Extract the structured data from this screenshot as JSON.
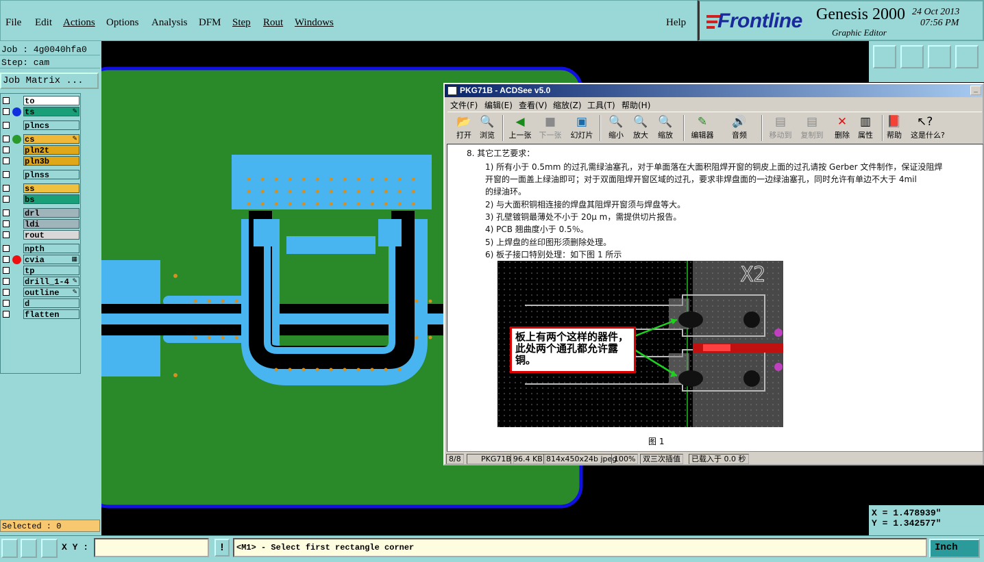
{
  "menu": {
    "items": [
      "File",
      "Edit",
      "Actions",
      "Options",
      "Analysis",
      "DFM",
      "Step",
      "Rout",
      "Windows"
    ],
    "help": "Help"
  },
  "brand": {
    "logo": "Frontline",
    "app_name": "Genesis 2000",
    "subtitle": "Graphic Editor",
    "date": "24 Oct 2013",
    "time": "07:56 PM"
  },
  "job": {
    "job_line": "Job : 4g0040hfa0",
    "step_line": "Step: cam",
    "matrix_button": "Job Matrix ..."
  },
  "layers": [
    {
      "name": "to",
      "color": "#ffffff",
      "dot": "",
      "flag": ""
    },
    {
      "name": "ts",
      "color": "#1aa079",
      "dot": "#1030e0",
      "flag": "✎"
    },
    {
      "name": "plncs",
      "color": "#9ad8d8",
      "dot": "",
      "flag": ""
    },
    {
      "name": "cs",
      "color": "#f0b838",
      "dot": "#2a9a2a",
      "flag": "✎"
    },
    {
      "name": "pln2t",
      "color": "#e0a818",
      "dot": "",
      "flag": ""
    },
    {
      "name": "pln3b",
      "color": "#e0a818",
      "dot": "",
      "flag": ""
    },
    {
      "name": "plnss",
      "color": "#9ad8d8",
      "dot": "",
      "flag": ""
    },
    {
      "name": "ss",
      "color": "#f0c040",
      "dot": "",
      "flag": ""
    },
    {
      "name": "bs",
      "color": "#1aa079",
      "dot": "",
      "flag": ""
    },
    {
      "name": "drl",
      "color": "#a0b4bc",
      "dot": "",
      "flag": ""
    },
    {
      "name": "ldi",
      "color": "#a0b4bc",
      "dot": "",
      "flag": ""
    },
    {
      "name": "rout",
      "color": "#d8d8d8",
      "dot": "",
      "flag": ""
    },
    {
      "name": "npth",
      "color": "#9ad8d8",
      "dot": "",
      "flag": ""
    },
    {
      "name": "cvia",
      "color": "#9ad8d8",
      "dot": "#ee1010",
      "flag": "▦"
    },
    {
      "name": "tp",
      "color": "#9ad8d8",
      "dot": "",
      "flag": ""
    },
    {
      "name": "drill_1-4",
      "color": "#9ad8d8",
      "dot": "",
      "flag": "✎"
    },
    {
      "name": "outline",
      "color": "#9ad8d8",
      "dot": "",
      "flag": "✎"
    },
    {
      "name": "d",
      "color": "#9ad8d8",
      "dot": "",
      "flag": ""
    },
    {
      "name": "flatten",
      "color": "#9ad8d8",
      "dot": "",
      "flag": ""
    }
  ],
  "selected": "Selected : 0",
  "coords": {
    "x": "X = 1.478939\"",
    "y": "Y = 1.342577\""
  },
  "bottom": {
    "xy_label": "X Y :",
    "xy_value": "",
    "prompt": "<M1> - Select first rectangle corner",
    "unit": "Inch",
    "exclaim": "!"
  },
  "acdsee": {
    "title": "PKG71B - ACDSee v5.0",
    "menu": [
      "文件(F)",
      "编辑(E)",
      "查看(V)",
      "缩放(Z)",
      "工具(T)",
      "帮助(H)"
    ],
    "toolbar": [
      {
        "label": "打开",
        "icon": "folder-open-icon",
        "enabled": true
      },
      {
        "label": "浏览",
        "icon": "browse-icon",
        "enabled": true
      },
      {
        "label": "上一张",
        "icon": "previous-icon",
        "enabled": true
      },
      {
        "label": "下一张",
        "icon": "next-icon",
        "enabled": false
      },
      {
        "label": "幻灯片",
        "icon": "slideshow-icon",
        "enabled": true
      },
      {
        "label": "缩小",
        "icon": "zoom-out-icon",
        "enabled": true
      },
      {
        "label": "放大",
        "icon": "zoom-in-icon",
        "enabled": true
      },
      {
        "label": "缩放",
        "icon": "zoom-icon",
        "enabled": true
      },
      {
        "label": "编辑器",
        "icon": "editor-icon",
        "enabled": true
      },
      {
        "label": "音频",
        "icon": "audio-icon",
        "enabled": true
      },
      {
        "label": "移动到",
        "icon": "move-icon",
        "enabled": false
      },
      {
        "label": "复制到",
        "icon": "copy-icon",
        "enabled": false
      },
      {
        "label": "删除",
        "icon": "delete-icon",
        "enabled": true
      },
      {
        "label": "属性",
        "icon": "properties-icon",
        "enabled": true
      },
      {
        "label": "帮助",
        "icon": "help-book-icon",
        "enabled": true
      },
      {
        "label": "这是什么?",
        "icon": "whats-this-icon",
        "enabled": true
      }
    ],
    "doc": {
      "heading": "8.    其它工艺要求：",
      "items": [
        "1)   所有小于 0.5mm 的过孔需绿油塞孔，对于单面落在大面积阻焊开窗的铜皮上面的过孔请按 Gerber 文件制作，保证没阻焊",
        "      开窗的一面盖上绿油即可；对于双面阻焊开窗区域的过孔，要求非焊盘面的一边绿油塞孔，同时允许有单边不大于 4mil",
        "      的绿油环。",
        "2)   与大面积铜相连接的焊盘其阻焊开窗须与焊盘等大。",
        "3)   孔壁镀铜最薄处不小于 20μ m，需提供切片报告。",
        "4)   PCB 翘曲度小于 0.5％。",
        "5)   上焊盘的丝印图形须删除处理。",
        "6)   板子接口特别处理：如下图 1 所示"
      ],
      "figure_label": "X2",
      "callout": "板上有两个这样的器件，此处两个通孔都允许露铜。",
      "caption": "图 1"
    },
    "status": [
      "8/8",
      "PKG71B",
      "96.4 KB",
      "814x450x24b jpeg",
      "100%",
      "双三次插值",
      "已载入于 0.0 秒"
    ]
  }
}
